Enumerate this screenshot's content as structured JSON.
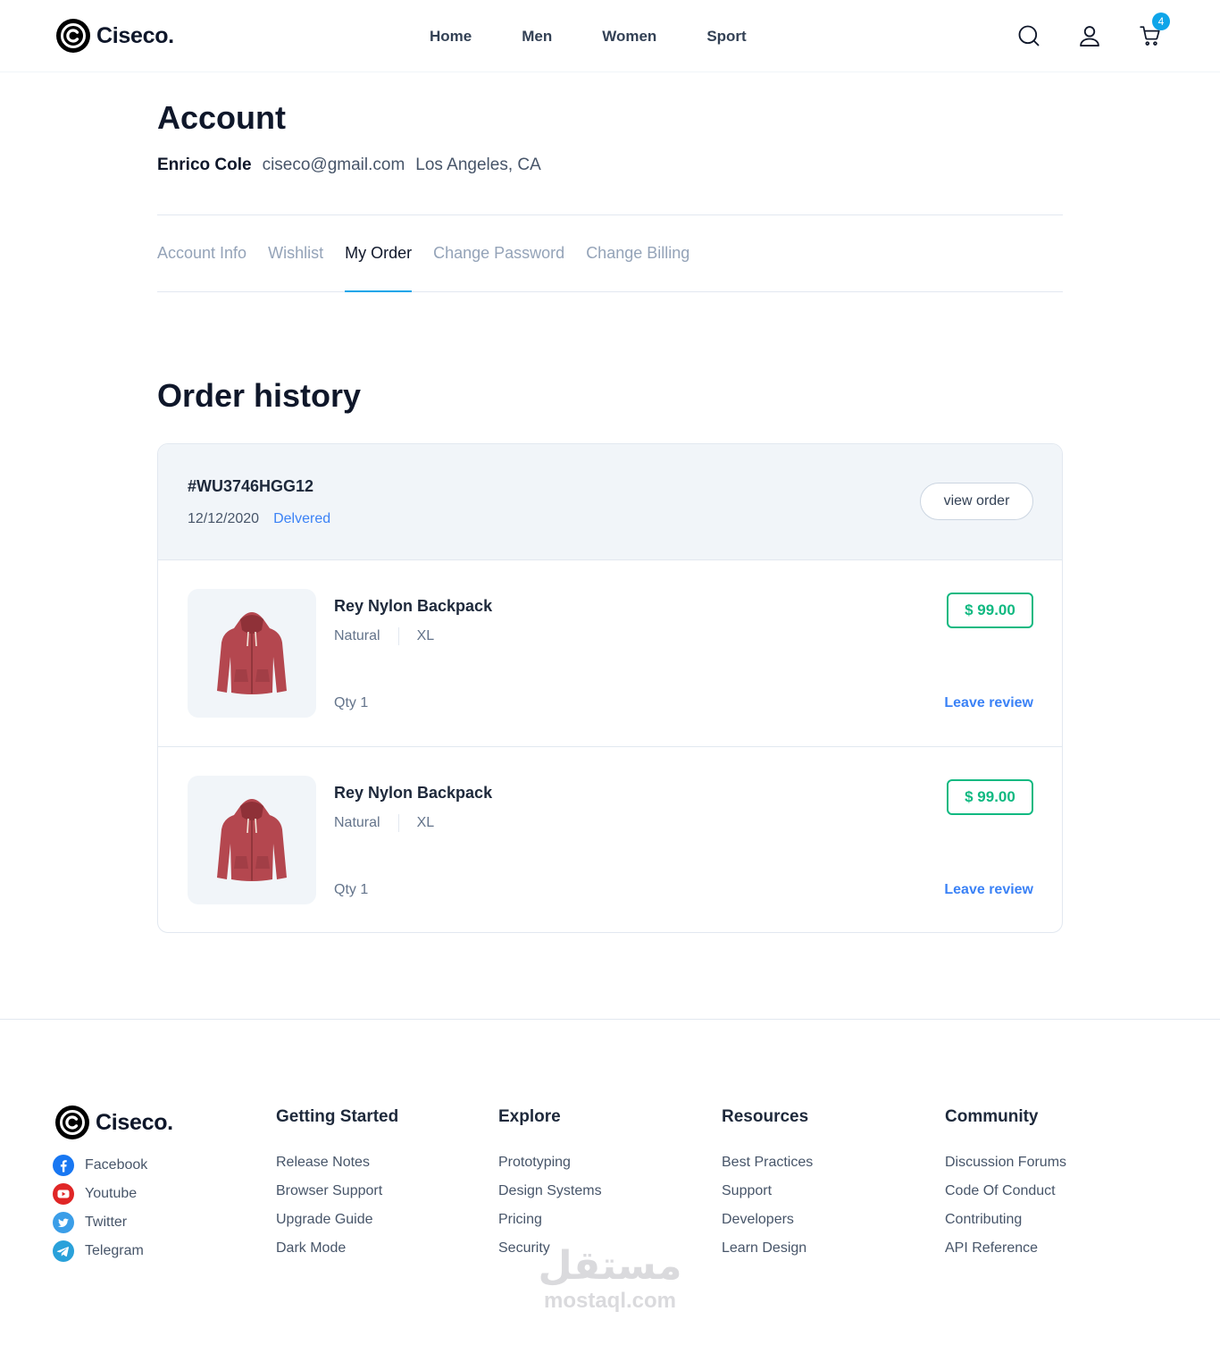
{
  "brand": {
    "name": "Ciseco."
  },
  "nav": {
    "items": [
      "Home",
      "Men",
      "Women",
      "Sport"
    ]
  },
  "header": {
    "cart_count": "4"
  },
  "account": {
    "title": "Account",
    "name": "Enrico Cole",
    "email": "ciseco@gmail.com",
    "location": "Los Angeles, CA"
  },
  "tabs": [
    {
      "label": "Account Info",
      "active": false
    },
    {
      "label": "Wishlist",
      "active": false
    },
    {
      "label": "My Order",
      "active": true
    },
    {
      "label": "Change Password",
      "active": false
    },
    {
      "label": "Change Billing",
      "active": false
    }
  ],
  "orders": {
    "title": "Order history",
    "order": {
      "id": "#WU3746HGG12",
      "date": "12/12/2020",
      "status": "Delvered",
      "view_label": "view order",
      "items": [
        {
          "name": "Rey Nylon Backpack",
          "color": "Natural",
          "size": "XL",
          "qty": "Qty 1",
          "price": "$ 99.00",
          "review_label": "Leave review"
        },
        {
          "name": "Rey Nylon Backpack",
          "color": "Natural",
          "size": "XL",
          "qty": "Qty 1",
          "price": "$ 99.00",
          "review_label": "Leave review"
        }
      ]
    }
  },
  "footer": {
    "brand": "Ciseco.",
    "social": [
      {
        "label": "Facebook",
        "icon": "facebook-icon"
      },
      {
        "label": "Youtube",
        "icon": "youtube-icon"
      },
      {
        "label": "Twitter",
        "icon": "twitter-icon"
      },
      {
        "label": "Telegram",
        "icon": "telegram-icon"
      }
    ],
    "columns": [
      {
        "title": "Getting Started",
        "links": [
          "Release Notes",
          "Browser Support",
          "Upgrade Guide",
          "Dark Mode"
        ]
      },
      {
        "title": "Explore",
        "links": [
          "Prototyping",
          "Design Systems",
          "Pricing",
          "Security"
        ]
      },
      {
        "title": "Resources",
        "links": [
          "Best Practices",
          "Support",
          "Developers",
          "Learn Design"
        ]
      },
      {
        "title": "Community",
        "links": [
          "Discussion Forums",
          "Code Of Conduct",
          "Contributing",
          "API Reference"
        ]
      }
    ]
  },
  "watermark": {
    "arabic": "مستقل",
    "latin": "mostaql.com"
  },
  "colors": {
    "accent": "#0ea5e9",
    "price": "#10b981",
    "link": "#3b82f6"
  }
}
